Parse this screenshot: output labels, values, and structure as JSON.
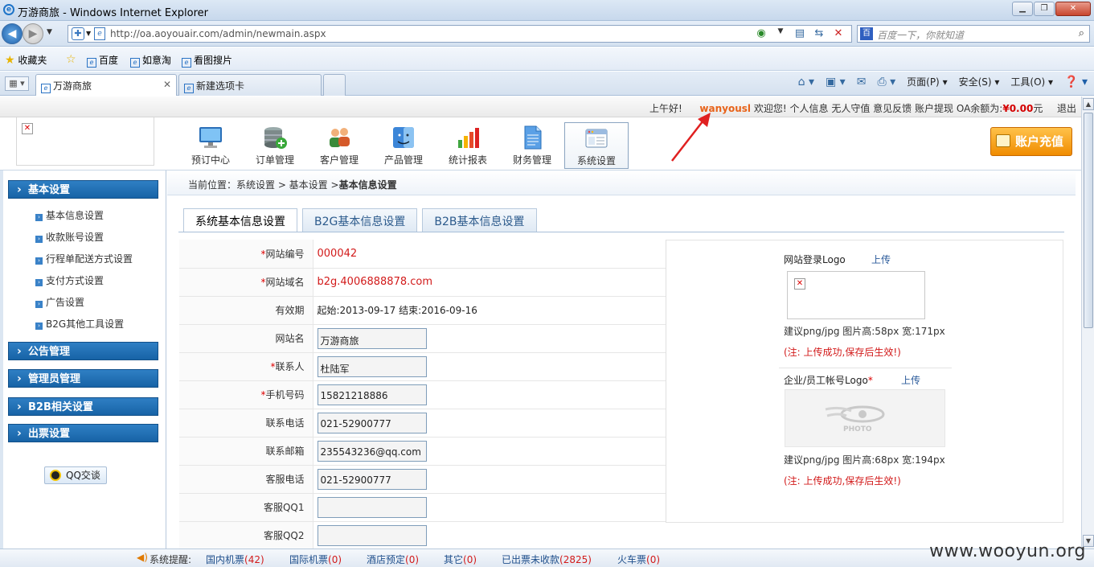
{
  "window": {
    "title": "万游商旅 - Windows Internet Explorer"
  },
  "address": {
    "url": "http://oa.aoyouair.com/admin/newmain.aspx",
    "search_placeholder": "百度一下，你就知道"
  },
  "favorites": {
    "label": "收藏夹",
    "items": [
      "百度",
      "如意淘",
      "看图搜片"
    ]
  },
  "tabs": [
    {
      "label": "万游商旅",
      "active": true
    },
    {
      "label": "新建选项卡",
      "active": false
    }
  ],
  "commandbar": {
    "page": "页面(P)",
    "safety": "安全(S)",
    "tools": "工具(O)"
  },
  "userbar": {
    "greeting": "上午好!",
    "username": "wanyousl",
    "welcome": "欢迎您!",
    "links": [
      "个人信息",
      "无人守值",
      "意见反馈",
      "账户提现"
    ],
    "balance_label": "OA余额为:",
    "balance": "¥0.00",
    "balance_unit": "元",
    "logout": "退出"
  },
  "mainnav": [
    {
      "label": "预订中心",
      "icon": "monitor-icon",
      "active": false
    },
    {
      "label": "订单管理",
      "icon": "database-add-icon",
      "active": false
    },
    {
      "label": "客户管理",
      "icon": "users-icon",
      "active": false
    },
    {
      "label": "产品管理",
      "icon": "finder-icon",
      "active": false
    },
    {
      "label": "统计报表",
      "icon": "bar-chart-icon",
      "active": false
    },
    {
      "label": "财务管理",
      "icon": "document-icon",
      "active": false
    },
    {
      "label": "系统设置",
      "icon": "window-icon",
      "active": true
    }
  ],
  "recharge_label": "账户充值",
  "sidebar": {
    "sections": [
      {
        "label": "基本设置",
        "items": [
          "基本信息设置",
          "收款账号设置",
          "行程单配送方式设置",
          "支付方式设置",
          "广告设置",
          "B2G其他工具设置"
        ]
      },
      {
        "label": "公告管理",
        "items": []
      },
      {
        "label": "管理员管理",
        "items": []
      },
      {
        "label": "B2B相关设置",
        "items": []
      },
      {
        "label": "出票设置",
        "items": []
      }
    ],
    "qq_label": "QQ交谈"
  },
  "breadcrumb": {
    "prefix": "当前位置：系统设置 > 基本设置 >",
    "current": "基本信息设置"
  },
  "content_tabs": [
    "系统基本信息设置",
    "B2G基本信息设置",
    "B2B基本信息设置"
  ],
  "form": {
    "site_no": {
      "label": "网站编号",
      "value": "000042"
    },
    "domain": {
      "label": "网站域名",
      "value": "b2g.4006888878.com"
    },
    "validity": {
      "label": "有效期",
      "value": "起始:2013-09-17 结束:2016-09-16"
    },
    "site_name": {
      "label": "网站名",
      "value": "万游商旅"
    },
    "contact": {
      "label": "联系人",
      "value": "杜陆军"
    },
    "mobile": {
      "label": "手机号码",
      "value": "15821218886"
    },
    "phone": {
      "label": "联系电话",
      "value": "021-52900777"
    },
    "email": {
      "label": "联系邮箱",
      "value": "235543236@qq.com"
    },
    "service_phone": {
      "label": "客服电话",
      "value": "021-52900777"
    },
    "qq1": {
      "label": "客服QQ1",
      "value": ""
    },
    "qq2": {
      "label": "客服QQ2",
      "value": ""
    }
  },
  "logos": {
    "login_logo_label": "网站登录Logo",
    "upload": "上传",
    "login_hint": "建议png/jpg 图片高:58px 宽:171px",
    "note": "(注: 上传成功,保存后生效!)",
    "account_logo_label": "企业/员工帐号Logo",
    "account_hint": "建议png/jpg 图片高:68px 宽:194px",
    "photo_text": "PHOTO"
  },
  "statusbar": {
    "label": "系统提醒:",
    "items": [
      {
        "label": "国内机票",
        "count": "(42)"
      },
      {
        "label": "国际机票",
        "count": "(0)"
      },
      {
        "label": "酒店预定",
        "count": "(0)"
      },
      {
        "label": "其它",
        "count": "(0)"
      },
      {
        "label": "已出票未收款",
        "count": "(2825)"
      },
      {
        "label": "火车票",
        "count": "(0)"
      }
    ]
  },
  "watermark": "www.wooyun.org"
}
